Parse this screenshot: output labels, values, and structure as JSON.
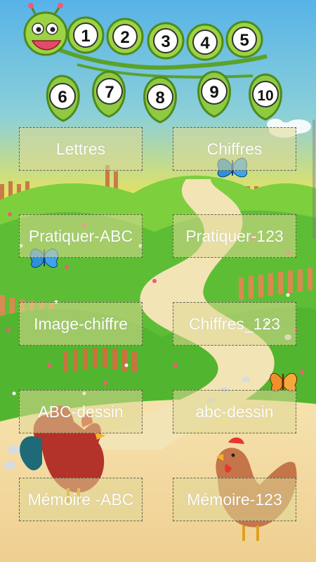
{
  "header": {
    "caterpillar_numbers": [
      "1",
      "2",
      "3",
      "4",
      "5",
      "6",
      "7",
      "8",
      "9",
      "10"
    ]
  },
  "menu": {
    "buttons": [
      {
        "label": "Lettres"
      },
      {
        "label": "Chiffres"
      },
      {
        "label": "Pratiquer-ABC"
      },
      {
        "label": "Pratiquer-123"
      },
      {
        "label": "Image-chiffre"
      },
      {
        "label": "Chiffres_123"
      },
      {
        "label": "ABC-dessin"
      },
      {
        "label": "abc-dessin"
      },
      {
        "label": "Mémoire -ABC"
      },
      {
        "label": "Mémoire-123"
      }
    ]
  },
  "colors": {
    "sky_top": "#5BB4E6",
    "sky_bottom": "#F2E44A",
    "hill": "#5FBF3A",
    "path": "#F2DFB0",
    "button_text": "#FFFFFF"
  },
  "icons": [
    "caterpillar-icon",
    "blue-butterfly-icon",
    "orange-butterfly-icon",
    "rooster-icon",
    "hen-icon"
  ]
}
